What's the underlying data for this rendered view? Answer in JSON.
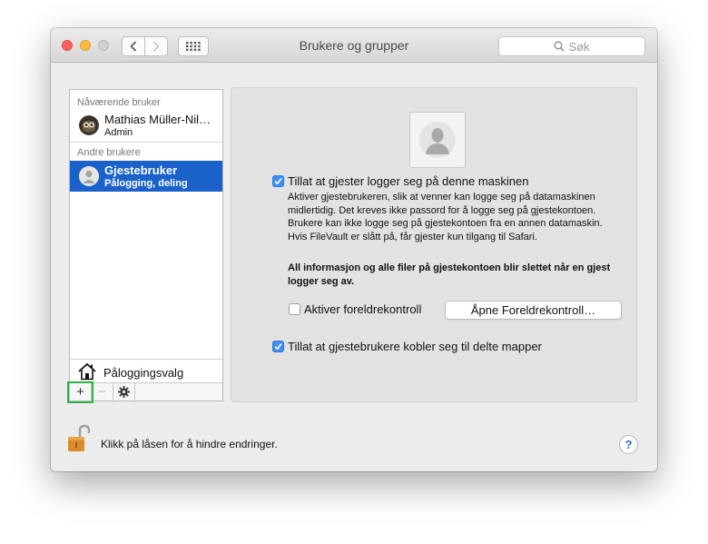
{
  "window": {
    "title": "Brukere og grupper",
    "search_placeholder": "Søk"
  },
  "sidebar": {
    "current_header": "Nåværende bruker",
    "current_user": {
      "name": "Mathias Müller-Nil…",
      "role": "Admin"
    },
    "others_header": "Andre brukere",
    "other_users": [
      {
        "name": "Gjestebruker",
        "role": "Pålogging, deling",
        "selected": true
      }
    ],
    "login_options": "Påloggingsvalg",
    "toolbar": {
      "add": "+",
      "remove": "−"
    }
  },
  "panel": {
    "allow_guest": {
      "label": "Tillat at gjester logger seg på denne maskinen",
      "checked": true
    },
    "description": "Aktiver gjestebrukeren, slik at venner kan logge seg på datamaskinen midlertidig. Det kreves ikke passord for å logge seg på gjestekontoen. Brukere kan ikke logge seg på gjestekontoen fra en annen datamaskin. Hvis FileVault er slått på, får gjester kun tilgang til Safari.",
    "warning": "All informasjon og alle filer på gjestekontoen blir slettet når en gjest logger seg av.",
    "parental": {
      "label": "Aktiver foreldrekontroll",
      "checked": false
    },
    "parental_button": "Åpne Foreldrekontroll…",
    "shared_folders": {
      "label": "Tillat at gjestebrukere kobler seg til delte mapper",
      "checked": true
    }
  },
  "footer": {
    "lock_text": "Klikk på låsen for å hindre endringer.",
    "help": "?"
  },
  "colors": {
    "selection": "#1a62c9",
    "checkbox": "#3f8ef5",
    "highlight": "#2db24a"
  }
}
